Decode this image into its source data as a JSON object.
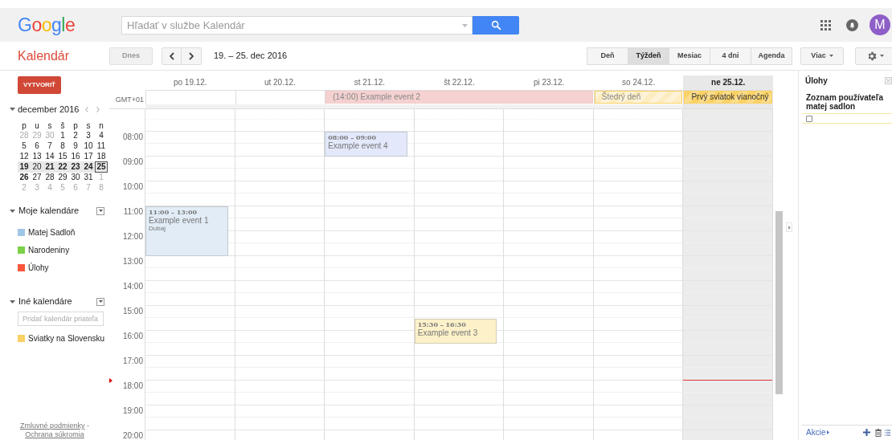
{
  "header": {
    "logo": "Google",
    "search": {
      "placeholder": "Hľadať v službe Kalendár"
    },
    "avatar": "M"
  },
  "toolbar": {
    "app_title": "Kalendár",
    "today_button": "Dnes",
    "range": "19. – 25. dec 2016",
    "views": [
      {
        "label": "Deň",
        "selected": false
      },
      {
        "label": "Týždeň",
        "selected": true
      },
      {
        "label": "Mesiac",
        "selected": false
      },
      {
        "label": "4 dni",
        "selected": false
      },
      {
        "label": "Agenda",
        "selected": false
      }
    ],
    "more_button": "Viac"
  },
  "sidebar": {
    "create_button": "VYTVORIŤ",
    "mini_calendar": {
      "title": "december 2016",
      "weekdays": [
        "p",
        "u",
        "s",
        "š",
        "p",
        "s",
        "n"
      ],
      "weeks": [
        {
          "selected": false,
          "days": [
            {
              "label": "28",
              "other_month": true,
              "bold": false,
              "today": false
            },
            {
              "label": "29",
              "other_month": true,
              "bold": false,
              "today": false
            },
            {
              "label": "30",
              "other_month": true,
              "bold": false,
              "today": false
            },
            {
              "label": "1",
              "other_month": false,
              "bold": false,
              "today": false
            },
            {
              "label": "2",
              "other_month": false,
              "bold": false,
              "today": false
            },
            {
              "label": "3",
              "other_month": false,
              "bold": false,
              "today": false
            },
            {
              "label": "4",
              "other_month": false,
              "bold": false,
              "today": false
            }
          ]
        },
        {
          "selected": false,
          "days": [
            {
              "label": "5",
              "other_month": false,
              "bold": false,
              "today": false
            },
            {
              "label": "6",
              "other_month": false,
              "bold": false,
              "today": false
            },
            {
              "label": "7",
              "other_month": false,
              "bold": false,
              "today": false
            },
            {
              "label": "8",
              "other_month": false,
              "bold": false,
              "today": false
            },
            {
              "label": "9",
              "other_month": false,
              "bold": false,
              "today": false
            },
            {
              "label": "10",
              "other_month": false,
              "bold": false,
              "today": false
            },
            {
              "label": "11",
              "other_month": false,
              "bold": false,
              "today": false
            }
          ]
        },
        {
          "selected": false,
          "days": [
            {
              "label": "12",
              "other_month": false,
              "bold": false,
              "today": false
            },
            {
              "label": "13",
              "other_month": false,
              "bold": false,
              "today": false
            },
            {
              "label": "14",
              "other_month": false,
              "bold": false,
              "today": false
            },
            {
              "label": "15",
              "other_month": false,
              "bold": false,
              "today": false
            },
            {
              "label": "16",
              "other_month": false,
              "bold": false,
              "today": false
            },
            {
              "label": "17",
              "other_month": false,
              "bold": false,
              "today": false
            },
            {
              "label": "18",
              "other_month": false,
              "bold": false,
              "today": false
            }
          ]
        },
        {
          "selected": true,
          "days": [
            {
              "label": "19",
              "other_month": false,
              "bold": true,
              "today": false
            },
            {
              "label": "20",
              "other_month": false,
              "bold": false,
              "today": false
            },
            {
              "label": "21",
              "other_month": false,
              "bold": true,
              "today": false
            },
            {
              "label": "22",
              "other_month": false,
              "bold": true,
              "today": false
            },
            {
              "label": "23",
              "other_month": false,
              "bold": true,
              "today": false
            },
            {
              "label": "24",
              "other_month": false,
              "bold": true,
              "today": false
            },
            {
              "label": "25",
              "other_month": false,
              "bold": true,
              "today": true
            }
          ]
        },
        {
          "selected": false,
          "days": [
            {
              "label": "26",
              "other_month": false,
              "bold": true,
              "today": false
            },
            {
              "label": "27",
              "other_month": false,
              "bold": false,
              "today": false
            },
            {
              "label": "28",
              "other_month": false,
              "bold": false,
              "today": false
            },
            {
              "label": "29",
              "other_month": false,
              "bold": false,
              "today": false
            },
            {
              "label": "30",
              "other_month": false,
              "bold": false,
              "today": false
            },
            {
              "label": "31",
              "other_month": false,
              "bold": false,
              "today": false
            },
            {
              "label": "1",
              "other_month": true,
              "bold": false,
              "today": false
            }
          ]
        },
        {
          "selected": false,
          "days": [
            {
              "label": "2",
              "other_month": true,
              "bold": false,
              "today": false
            },
            {
              "label": "3",
              "other_month": true,
              "bold": false,
              "today": false
            },
            {
              "label": "4",
              "other_month": true,
              "bold": false,
              "today": false
            },
            {
              "label": "5",
              "other_month": true,
              "bold": false,
              "today": false
            },
            {
              "label": "6",
              "other_month": true,
              "bold": false,
              "today": false
            },
            {
              "label": "7",
              "other_month": true,
              "bold": false,
              "today": false
            },
            {
              "label": "8",
              "other_month": true,
              "bold": false,
              "today": false
            }
          ]
        }
      ]
    },
    "my_calendars": {
      "title": "Moje kalendáre",
      "items": [
        {
          "label": "Matej Sadloň",
          "color": "#9fc6e7"
        },
        {
          "label": "Narodeniny",
          "color": "#7bd148"
        },
        {
          "label": "Úlohy",
          "color": "#fa573c"
        }
      ]
    },
    "other_calendars": {
      "title": "Iné kalendáre",
      "add_field": {
        "placeholder": "Pridať kalendár priateľa"
      },
      "items": [
        {
          "label": "Sviatky na Slovensku",
          "color": "#fad165"
        }
      ]
    },
    "footer": {
      "terms": "Zmluvné podmienky",
      "separator": "-",
      "privacy": "Ochrana súkromia"
    }
  },
  "week": {
    "timezone": "GMT+01",
    "days": [
      {
        "label": "po 19.12.",
        "today": false,
        "events": [
          {
            "time": "11:00 – 13:00",
            "title": "Example event 1",
            "location": "Dubaj",
            "color": "#e1ecf6"
          }
        ]
      },
      {
        "label": "ut 20.12.",
        "today": false
      },
      {
        "label": "st 21.12.",
        "today": false,
        "events": [
          {
            "time": "08:00 – 09:00",
            "title": "Example event 4",
            "color": "#e3e9fb"
          }
        ]
      },
      {
        "label": "št 22.12.",
        "today": false,
        "events": [
          {
            "time": "15:30 – 16:30",
            "title": "Example event 3",
            "color": "#fdf1c9"
          }
        ]
      },
      {
        "label": "pi 23.12.",
        "today": false
      },
      {
        "label": "so 24.12.",
        "today": false
      },
      {
        "label": "ne 25.12.",
        "today": true
      }
    ],
    "all_day_events": [
      {
        "title": "(14:00) Example event 2",
        "kind": "event",
        "color": "#f4cccc",
        "past": true
      },
      {
        "title": "Štedrý deň",
        "kind": "holiday",
        "color": "#fad165",
        "past": true
      },
      {
        "title": "Prvý sviatok vianočný",
        "kind": "holiday",
        "color": "#fad165",
        "past": false
      }
    ],
    "hours": [
      "08:00",
      "09:00",
      "10:00",
      "11:00",
      "12:00",
      "13:00",
      "14:00",
      "15:00",
      "16:00",
      "17:00",
      "18:00",
      "19:00",
      "20:00"
    ]
  },
  "tasks": {
    "title": "Úlohy",
    "list_title": "Zoznam používateľa matej sadlon",
    "items": [
      {
        "checked": false
      }
    ],
    "actions": "Akcie"
  }
}
